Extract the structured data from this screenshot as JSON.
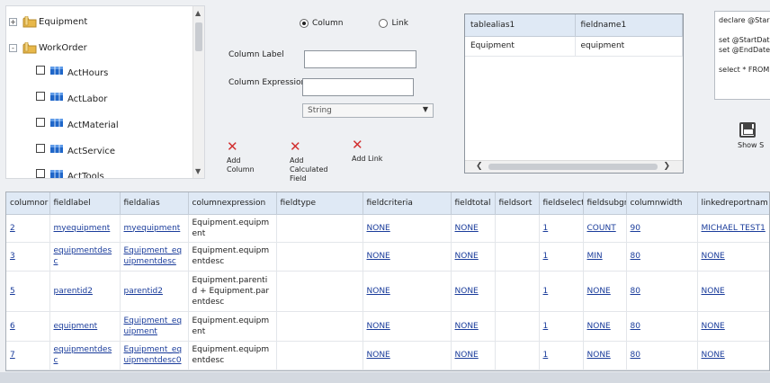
{
  "tree": {
    "nodes": [
      {
        "toggle": "+",
        "label": "Equipment"
      },
      {
        "toggle": "-",
        "label": "WorkOrder"
      }
    ],
    "children": [
      "ActHours",
      "ActLabor",
      "ActMaterial",
      "ActService",
      "ActTools"
    ]
  },
  "form": {
    "radio_column": "Column",
    "radio_link": "Link",
    "column_label": "Column Label",
    "column_expression": "Column Expression",
    "column_label_value": "",
    "column_expression_value": "",
    "type_selected": "String"
  },
  "actions": {
    "add_column": "Add Column",
    "add_calculated_field": "Add Calculated Field",
    "add_link": "Add Link"
  },
  "alias_grid": {
    "headers": [
      "tablealias1",
      "fieldname1"
    ],
    "rows": [
      [
        "Equipment",
        "equipment"
      ]
    ]
  },
  "sql": {
    "lines": [
      "declare @Star",
      "",
      "set @StartDat",
      "set @EndDate",
      "",
      "select * FROM"
    ]
  },
  "save_button": "Show S",
  "grid": {
    "headers": [
      "columnor",
      "fieldlabel",
      "fieldalias",
      "columnexpression",
      "fieldtype",
      "fieldcriteria",
      "fieldtotal",
      "fieldsort",
      "fieldselect",
      "fieldsubgr",
      "columnwidth",
      "linkedreportnam"
    ],
    "rows": [
      [
        "2",
        "myequipment",
        "myequipment",
        "Equipment.equipment",
        "",
        "NONE",
        "NONE",
        "",
        "1",
        "COUNT",
        "90",
        "MICHAEL TEST1"
      ],
      [
        "3",
        "equipmentdesc",
        "Equipment_equipmentdesc",
        "Equipment.equipmentdesc",
        "",
        "NONE",
        "NONE",
        "",
        "1",
        "MIN",
        "80",
        "NONE"
      ],
      [
        "5",
        "parentid2",
        "parentid2",
        "Equipment.parentid + Equipment.parentdesc",
        "",
        "NONE",
        "NONE",
        "",
        "1",
        "NONE",
        "80",
        "NONE"
      ],
      [
        "6",
        "equipment",
        "Equipment_equipment",
        "Equipment.equipment",
        "",
        "NONE",
        "NONE",
        "",
        "1",
        "NONE",
        "80",
        "NONE"
      ],
      [
        "7",
        "equipmentdesc",
        "Equipment_equipmentdesc0",
        "Equipment.equipmentdesc",
        "",
        "NONE",
        "NONE",
        "",
        "1",
        "NONE",
        "80",
        "NONE"
      ]
    ]
  },
  "colors": {
    "header_bg": "#dfe9f5",
    "link": "#1a3c9b",
    "delete_red": "#d23030",
    "table_icon": "#1f66c9",
    "folder": "#e8b84a"
  }
}
